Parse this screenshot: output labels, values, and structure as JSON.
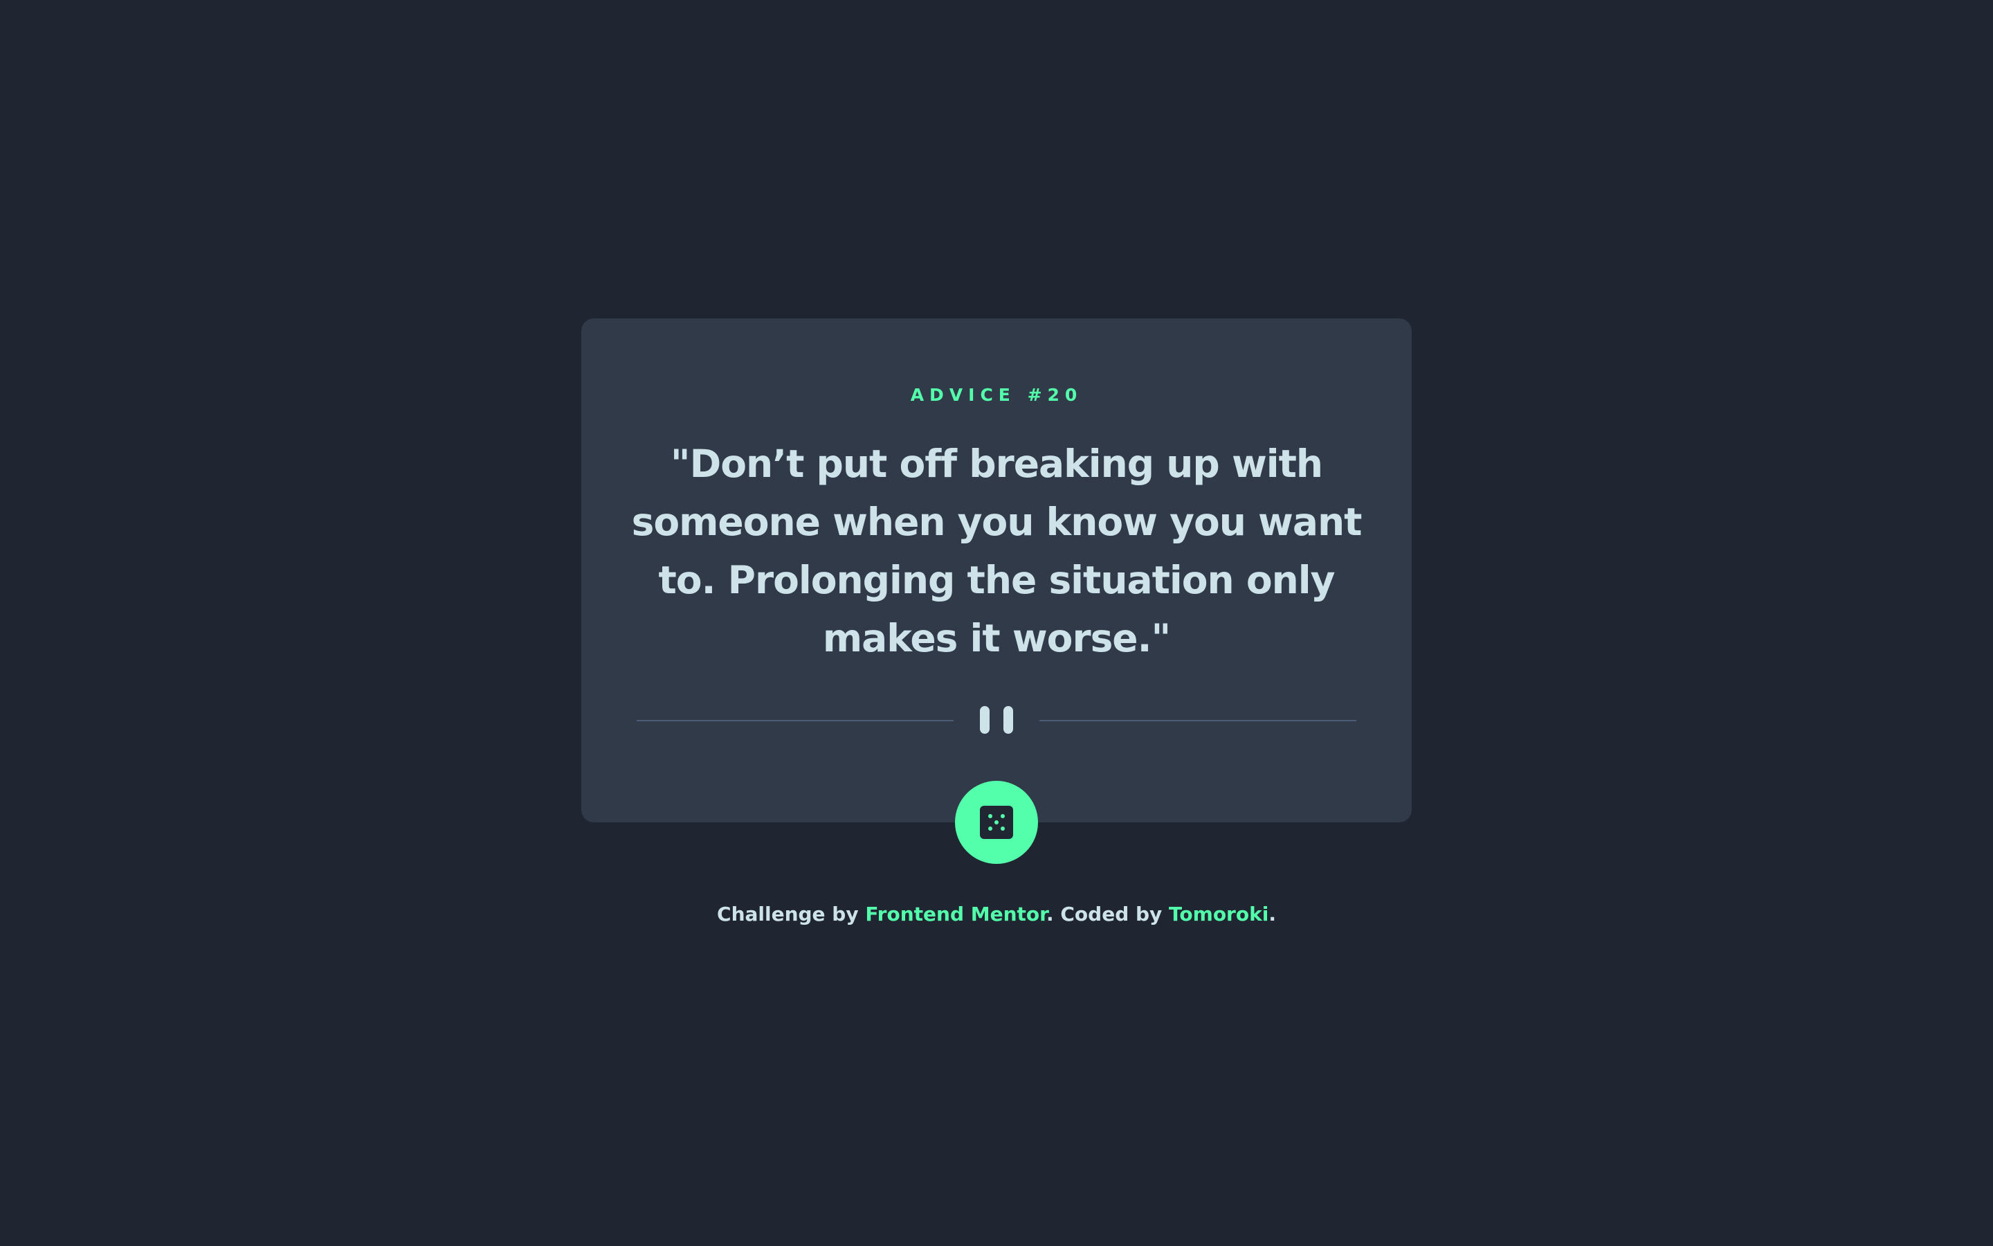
{
  "card": {
    "advice_label": "ADVICE #20",
    "quote": "\"Don’t put off breaking up with someone when you know you want to. Prolonging the situation only makes it worse.\""
  },
  "divider": {
    "icon": "pause-icon"
  },
  "dice_button": {
    "icon": "dice-icon"
  },
  "attribution": {
    "prefix": "Challenge by ",
    "link1": "Frontend Mentor",
    "middle": ". Coded by ",
    "link2": "Tomoroki",
    "suffix": "."
  },
  "colors": {
    "background": "#1f2632",
    "card": "#313a49",
    "accent": "#53ffaa",
    "text": "#cee3e9",
    "divider": "#4f5d74"
  }
}
